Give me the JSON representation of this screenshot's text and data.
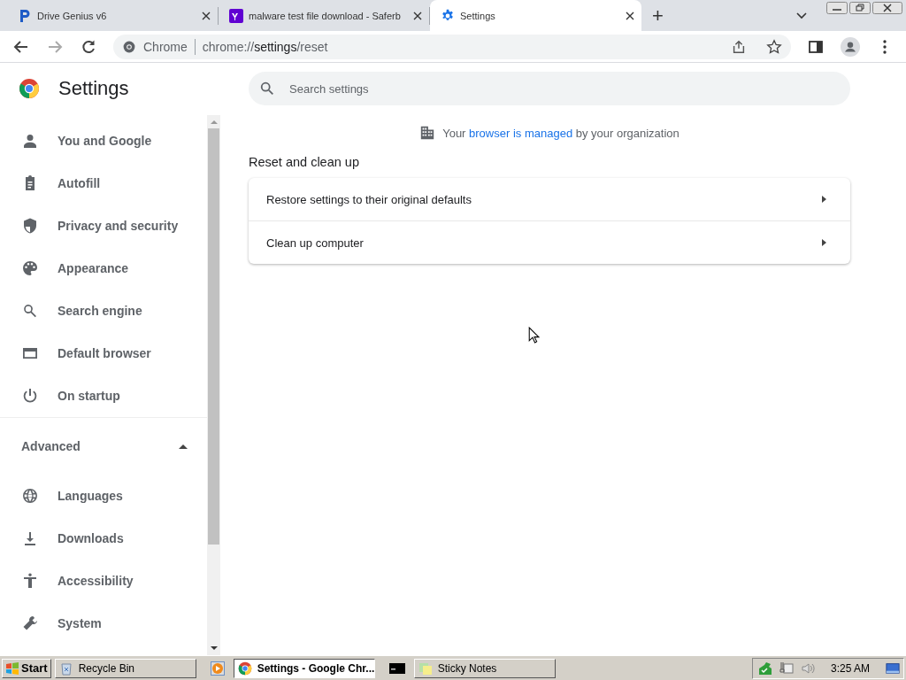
{
  "tabs": [
    {
      "title": "Drive Genius v6",
      "selected": false
    },
    {
      "title": "malware test file download - Saferb",
      "selected": false
    },
    {
      "title": "Settings",
      "selected": true
    }
  ],
  "new_tab": "+",
  "address_bar": {
    "site": "Chrome",
    "url_prefix": "chrome://",
    "url_host": "settings",
    "url_path": "/reset"
  },
  "sidebar": {
    "title": "Settings",
    "items": [
      {
        "label": "You and Google",
        "selected": false
      },
      {
        "label": "Autofill",
        "selected": false
      },
      {
        "label": "Privacy and security",
        "selected": false
      },
      {
        "label": "Appearance",
        "selected": false
      },
      {
        "label": "Search engine",
        "selected": false
      },
      {
        "label": "Default browser",
        "selected": false
      },
      {
        "label": "On startup",
        "selected": false
      }
    ],
    "advanced": {
      "label": "Advanced",
      "expanded": true,
      "items": [
        {
          "label": "Languages",
          "selected": false
        },
        {
          "label": "Downloads",
          "selected": false
        },
        {
          "label": "Accessibility",
          "selected": false
        },
        {
          "label": "System",
          "selected": false
        }
      ]
    }
  },
  "search": {
    "placeholder": "Search settings"
  },
  "managed_notice": {
    "before": "Your ",
    "link": "browser is managed",
    "after": " by your organization"
  },
  "section_title": "Reset and clean up",
  "rows": [
    {
      "label": "Restore settings to their original defaults"
    },
    {
      "label": "Clean up computer"
    }
  ],
  "taskbar": {
    "start": "Start",
    "buttons": [
      {
        "label": "Recycle Bin",
        "selected": false
      },
      {
        "label": "Settings - Google Chr...",
        "selected": true
      },
      {
        "label": "Sticky Notes",
        "selected": false
      }
    ],
    "clock": "3:25 AM"
  }
}
